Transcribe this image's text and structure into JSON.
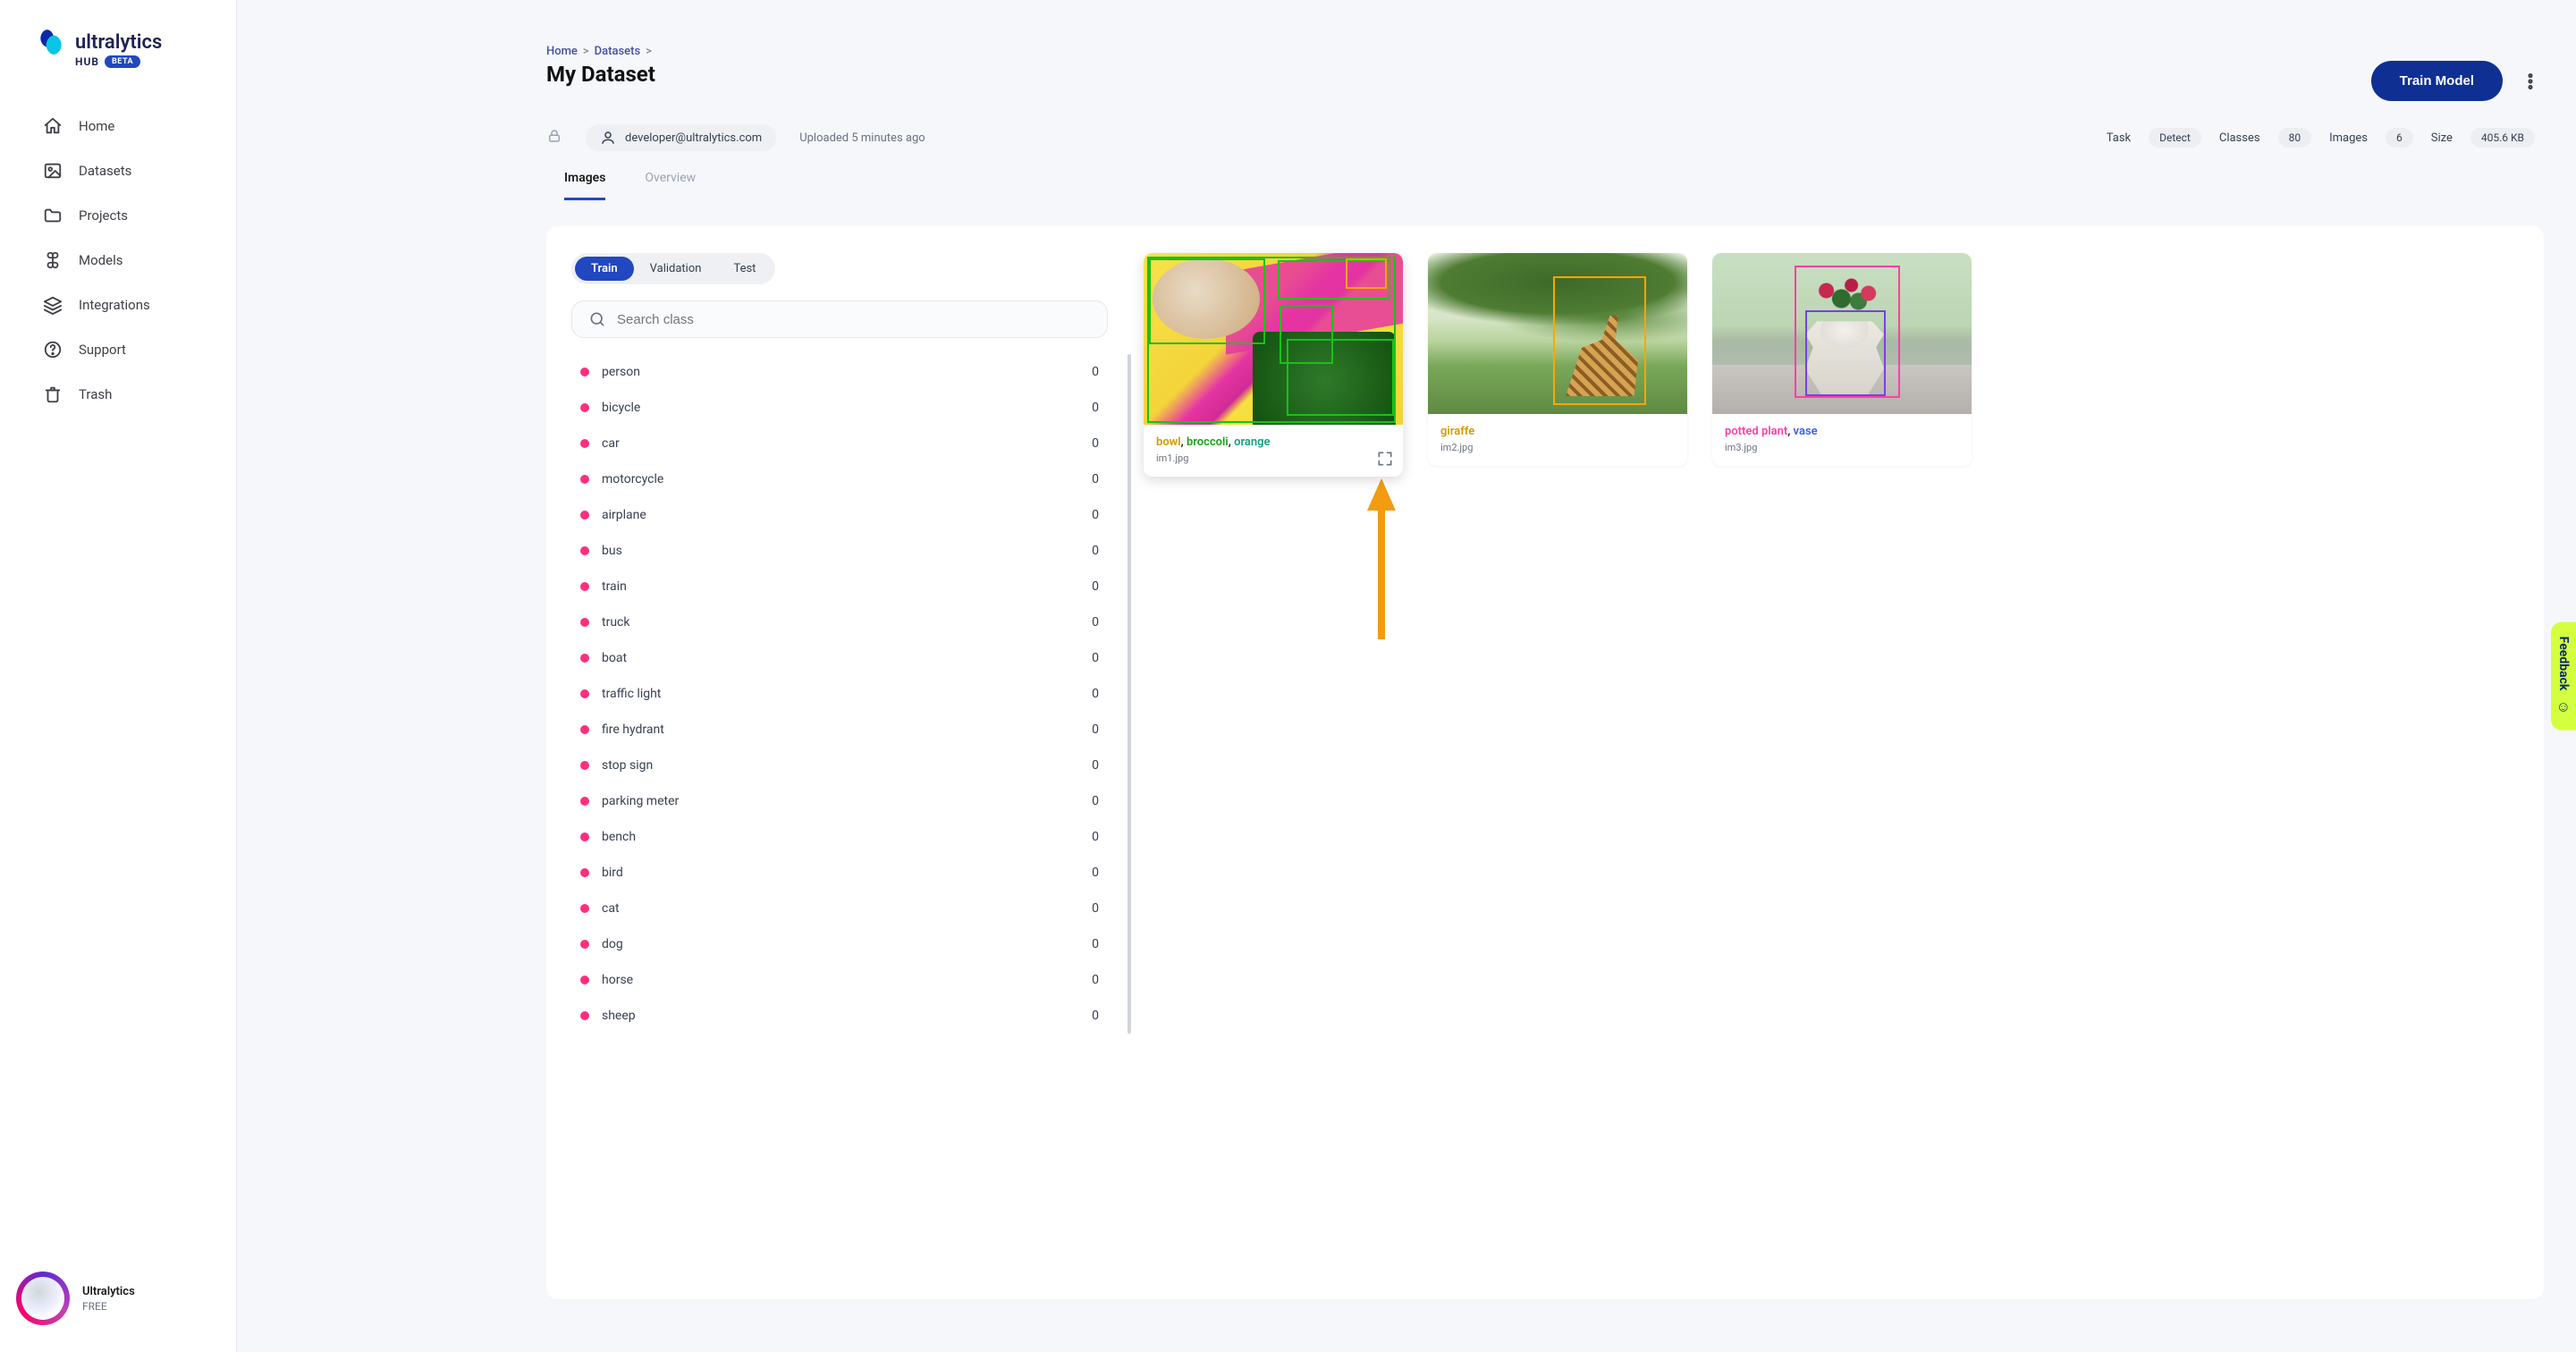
{
  "brand": {
    "word": "ultralytics",
    "hub": "HUB",
    "beta": "BETA"
  },
  "sidebar": {
    "items": [
      {
        "label": "Home",
        "icon": "home-icon"
      },
      {
        "label": "Datasets",
        "icon": "image-icon"
      },
      {
        "label": "Projects",
        "icon": "folder-icon"
      },
      {
        "label": "Models",
        "icon": "command-icon"
      },
      {
        "label": "Integrations",
        "icon": "layers-icon"
      },
      {
        "label": "Support",
        "icon": "help-icon"
      },
      {
        "label": "Trash",
        "icon": "trash-icon"
      }
    ],
    "footer": {
      "name": "Ultralytics",
      "plan": "FREE"
    }
  },
  "breadcrumb": [
    {
      "label": "Home"
    },
    {
      "label": "Datasets"
    }
  ],
  "page_title": "My Dataset",
  "actions": {
    "train": "Train Model"
  },
  "meta": {
    "owner": "developer@ultralytics.com",
    "uploaded": "Uploaded 5 minutes ago",
    "stats": [
      {
        "label": "Task",
        "value": "Detect"
      },
      {
        "label": "Classes",
        "value": "80"
      },
      {
        "label": "Images",
        "value": "6"
      },
      {
        "label": "Size",
        "value": "405.6 KB"
      }
    ]
  },
  "tabs": [
    {
      "label": "Images",
      "active": true
    },
    {
      "label": "Overview",
      "active": false
    }
  ],
  "splits": [
    {
      "label": "Train",
      "active": true
    },
    {
      "label": "Validation",
      "active": false
    },
    {
      "label": "Test",
      "active": false
    }
  ],
  "search": {
    "placeholder": "Search class"
  },
  "classes": [
    {
      "name": "person",
      "count": 0
    },
    {
      "name": "bicycle",
      "count": 0
    },
    {
      "name": "car",
      "count": 0
    },
    {
      "name": "motorcycle",
      "count": 0
    },
    {
      "name": "airplane",
      "count": 0
    },
    {
      "name": "bus",
      "count": 0
    },
    {
      "name": "train",
      "count": 0
    },
    {
      "name": "truck",
      "count": 0
    },
    {
      "name": "boat",
      "count": 0
    },
    {
      "name": "traffic light",
      "count": 0
    },
    {
      "name": "fire hydrant",
      "count": 0
    },
    {
      "name": "stop sign",
      "count": 0
    },
    {
      "name": "parking meter",
      "count": 0
    },
    {
      "name": "bench",
      "count": 0
    },
    {
      "name": "bird",
      "count": 0
    },
    {
      "name": "cat",
      "count": 0
    },
    {
      "name": "dog",
      "count": 0
    },
    {
      "name": "horse",
      "count": 0
    },
    {
      "name": "sheep",
      "count": 0
    }
  ],
  "images": [
    {
      "filename": "im1.jpg",
      "tags": [
        {
          "text": "bowl",
          "cls": "tag-bowl"
        },
        {
          "text": "broccoli",
          "cls": "tag-broc"
        },
        {
          "text": "orange",
          "cls": "tag-orange"
        }
      ],
      "hover": true
    },
    {
      "filename": "im2.jpg",
      "tags": [
        {
          "text": "giraffe",
          "cls": "tag-giraffe"
        }
      ],
      "hover": false
    },
    {
      "filename": "im3.jpg",
      "tags": [
        {
          "text": "potted plant",
          "cls": "tag-potted"
        },
        {
          "text": "vase",
          "cls": "tag-vase"
        }
      ],
      "hover": false
    }
  ],
  "feedback": {
    "label": "Feedback"
  }
}
